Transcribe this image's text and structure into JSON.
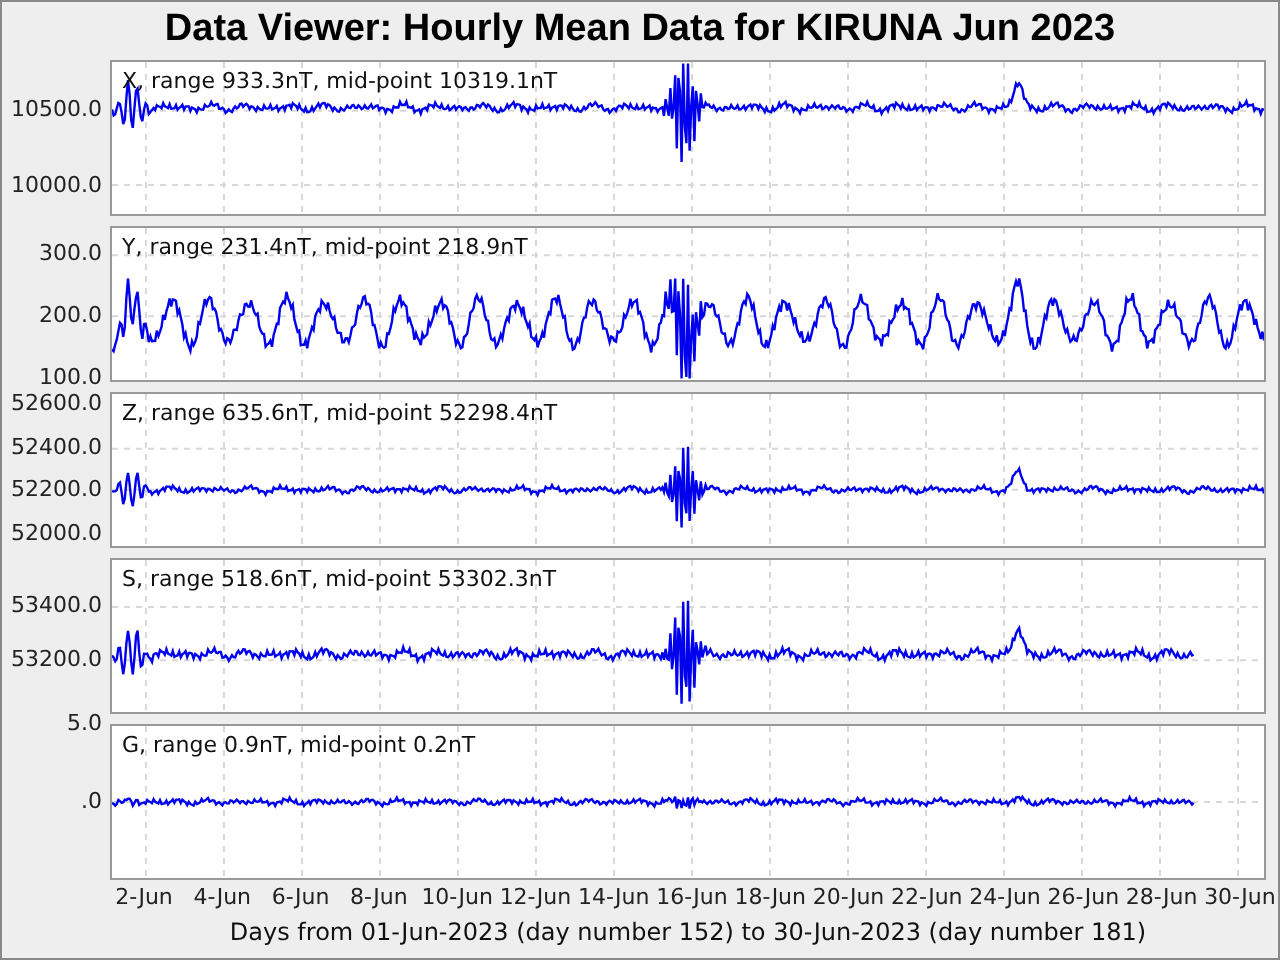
{
  "title": "Data Viewer:  Hourly Mean Data for KIRUNA Jun 2023",
  "panels": [
    {
      "label": "X, range 933.3nT, mid-point 10319.1nT",
      "y_ticks": [
        "10500.0",
        "10000.0"
      ]
    },
    {
      "label": "Y, range 231.4nT, mid-point 218.9nT",
      "y_ticks": [
        "300.0",
        "200.0",
        "100.0"
      ]
    },
    {
      "label": "Z, range 635.6nT, mid-point 52298.4nT",
      "y_ticks": [
        "52600.0",
        "52400.0",
        "52200.0",
        "52000.0"
      ]
    },
    {
      "label": "S, range 518.6nT, mid-point 53302.3nT",
      "y_ticks": [
        "53400.0",
        "53200.0"
      ]
    },
    {
      "label": "G, range 0.9nT, mid-point 0.2nT",
      "y_ticks": [
        "5.0",
        ".0"
      ]
    }
  ],
  "x_ticks": [
    "2-Jun",
    "4-Jun",
    "6-Jun",
    "8-Jun",
    "10-Jun",
    "12-Jun",
    "14-Jun",
    "16-Jun",
    "18-Jun",
    "20-Jun",
    "22-Jun",
    "24-Jun",
    "26-Jun",
    "28-Jun",
    "30-Jun"
  ],
  "x_axis_label": "Days from 01-Jun-2023 (day number 152) to 30-Jun-2023 (day number 181)"
}
